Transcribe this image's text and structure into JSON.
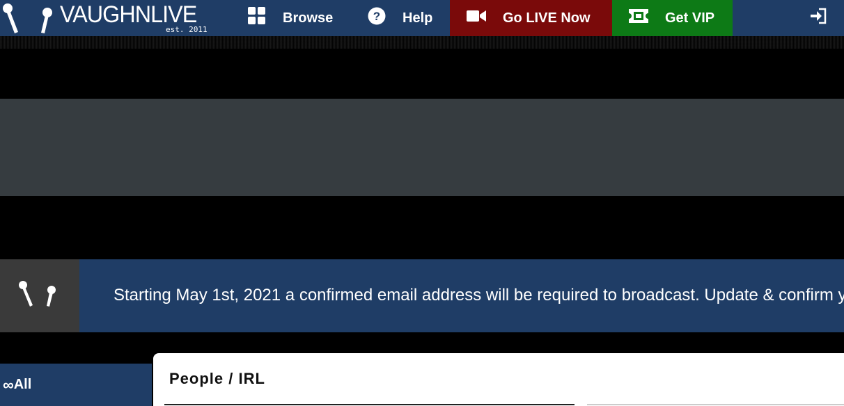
{
  "brand": {
    "name": "VAUGHNLIVE",
    "tagline": "est. 2011"
  },
  "nav": {
    "browse": "Browse",
    "help": "Help",
    "go_live": "Go LIVE Now",
    "get_vip": "Get VIP"
  },
  "colors": {
    "nav_bg": "#1f3d66",
    "go_live_bg": "#7a0a0a",
    "vip_bg": "#0d7a16"
  },
  "announcement": {
    "text": "Starting May 1st, 2021 a confirmed email address will be required to broadcast. Update & confirm y"
  },
  "sidebar": {
    "all_label": "All",
    "all_icon": "infinity-icon"
  },
  "main": {
    "category_title": "People / IRL"
  }
}
